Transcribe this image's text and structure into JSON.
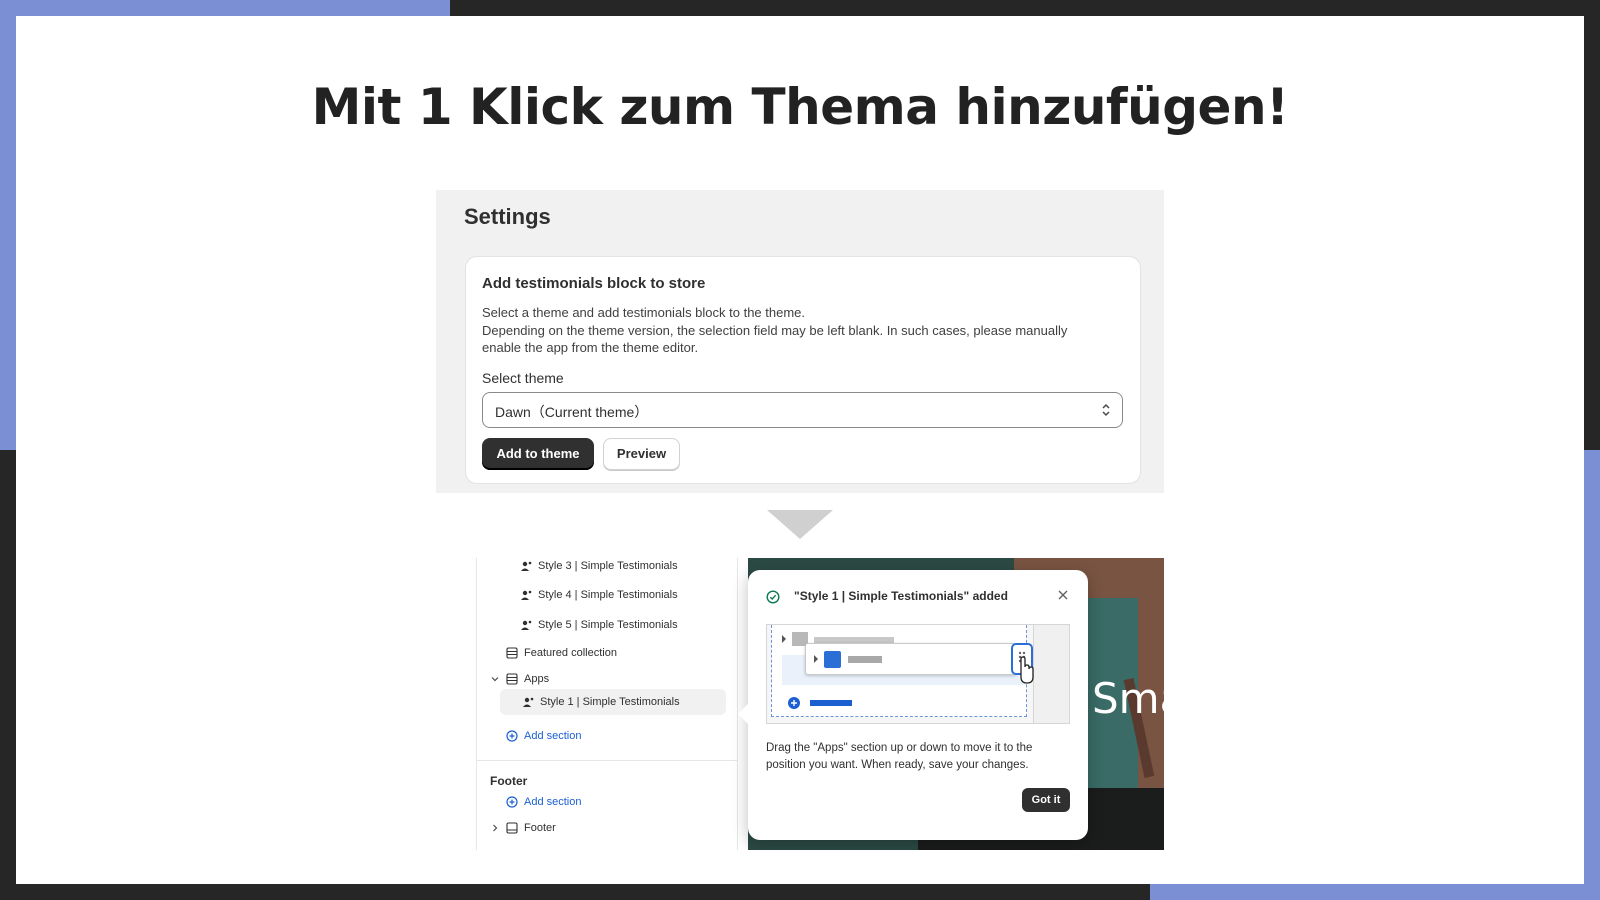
{
  "headline": "Mit 1 Klick zum Thema hinzufügen!",
  "colors": {
    "accent": "#7b8fd4",
    "dark": "#262626",
    "button_dark": "#303030",
    "link": "#1b5fd1"
  },
  "settings": {
    "title": "Settings",
    "card": {
      "title": "Add testimonials block to store",
      "desc_line1": "Select a theme and add testimonials block to the theme.",
      "desc_line2": "Depending on the theme version, the selection field may be left blank. In such cases, please manually",
      "desc_line3": "enable the app from the theme editor.",
      "select_label": "Select theme",
      "select_value": "Dawn（Current theme）",
      "add_button": "Add to theme",
      "preview_button": "Preview"
    }
  },
  "editor": {
    "sidebar": {
      "items": [
        {
          "label": "Style 3 | Simple Testimonials",
          "icon": "block-icon"
        },
        {
          "label": "Style 4 | Simple Testimonials",
          "icon": "block-icon"
        },
        {
          "label": "Style 5 | Simple Testimonials",
          "icon": "block-icon"
        },
        {
          "label": "Featured collection",
          "icon": "section-icon"
        },
        {
          "label": "Apps",
          "icon": "section-icon"
        },
        {
          "label": "Style 1 | Simple Testimonials",
          "icon": "block-icon"
        },
        {
          "label": "Add section",
          "icon": "plus-circle-icon"
        }
      ],
      "footer_heading": "Footer",
      "footer_add": "Add section",
      "footer_item": "Footer"
    },
    "preview_text": "Sma",
    "popover": {
      "title": "\"Style 1 | Simple Testimonials\" added",
      "body_line1": "Drag the \"Apps\" section up or down to move it to the",
      "body_line2": "position you want. When ready, save your changes.",
      "button": "Got it"
    }
  }
}
